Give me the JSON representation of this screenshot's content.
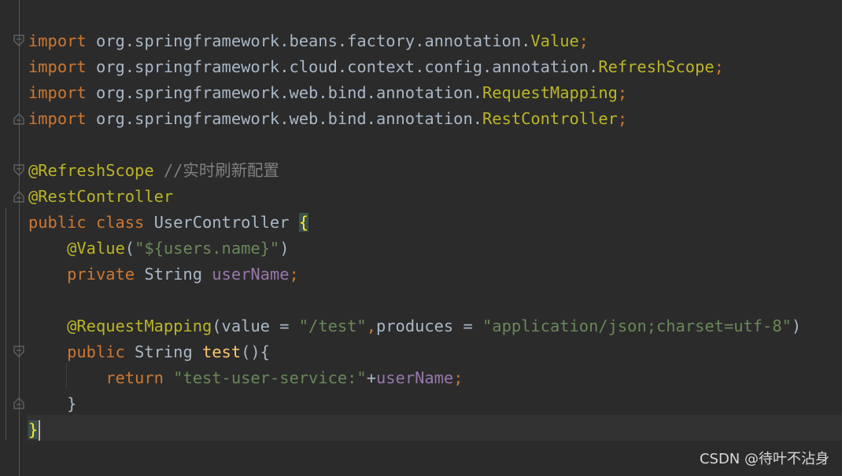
{
  "colors": {
    "keyword": "#cc7832",
    "annotation": "#bbb529",
    "string": "#6a8759",
    "field": "#9876aa",
    "plain": "#a9b7c6",
    "comment": "#808080",
    "method": "#ffc66d",
    "background": "#2b2b2b"
  },
  "icons": [
    "fold-open-icon",
    "fold-close-icon"
  ],
  "code": {
    "lines": [
      {
        "tokens": [
          {
            "t": "import",
            "c": "keyword"
          },
          {
            "t": " org.springframework.beans.factory.annotation.",
            "c": "plain"
          },
          {
            "t": "Value",
            "c": "annotation"
          },
          {
            "t": ";",
            "c": "keyword"
          }
        ]
      },
      {
        "tokens": [
          {
            "t": "import",
            "c": "keyword"
          },
          {
            "t": " org.springframework.cloud.context.config.annotation.",
            "c": "plain"
          },
          {
            "t": "RefreshScope",
            "c": "annotation"
          },
          {
            "t": ";",
            "c": "keyword"
          }
        ]
      },
      {
        "tokens": [
          {
            "t": "import",
            "c": "keyword"
          },
          {
            "t": " org.springframework.web.bind.annotation.",
            "c": "plain"
          },
          {
            "t": "RequestMapping",
            "c": "annotation"
          },
          {
            "t": ";",
            "c": "keyword"
          }
        ]
      },
      {
        "tokens": [
          {
            "t": "import",
            "c": "keyword"
          },
          {
            "t": " org.springframework.web.bind.annotation.",
            "c": "plain"
          },
          {
            "t": "RestController",
            "c": "annotation"
          },
          {
            "t": ";",
            "c": "keyword"
          }
        ]
      },
      {
        "tokens": []
      },
      {
        "tokens": [
          {
            "t": "@RefreshScope",
            "c": "annotation"
          },
          {
            "t": " //实时刷新配置",
            "c": "comment"
          }
        ]
      },
      {
        "tokens": [
          {
            "t": "@RestController",
            "c": "annotation"
          }
        ]
      },
      {
        "tokens": [
          {
            "t": "public class",
            "c": "keyword"
          },
          {
            "t": " UserController ",
            "c": "plain"
          },
          {
            "t": "{",
            "c": "brace"
          }
        ]
      },
      {
        "tokens": [
          {
            "t": "    ",
            "c": "plain"
          },
          {
            "t": "@Value",
            "c": "annotation"
          },
          {
            "t": "(",
            "c": "plain"
          },
          {
            "t": "\"${users.name}\"",
            "c": "string"
          },
          {
            "t": ")",
            "c": "plain"
          }
        ]
      },
      {
        "tokens": [
          {
            "t": "    ",
            "c": "plain"
          },
          {
            "t": "private",
            "c": "keyword"
          },
          {
            "t": " String ",
            "c": "plain"
          },
          {
            "t": "userName",
            "c": "field"
          },
          {
            "t": ";",
            "c": "keyword"
          }
        ]
      },
      {
        "tokens": []
      },
      {
        "tokens": [
          {
            "t": "    ",
            "c": "plain"
          },
          {
            "t": "@RequestMapping",
            "c": "annotation"
          },
          {
            "t": "(value = ",
            "c": "plain"
          },
          {
            "t": "\"/test\"",
            "c": "string"
          },
          {
            "t": ",",
            "c": "keyword"
          },
          {
            "t": "produces = ",
            "c": "plain"
          },
          {
            "t": "\"application/json;charset=utf-8\"",
            "c": "string"
          },
          {
            "t": ")",
            "c": "plain"
          }
        ]
      },
      {
        "tokens": [
          {
            "t": "    ",
            "c": "plain"
          },
          {
            "t": "public",
            "c": "keyword"
          },
          {
            "t": " String ",
            "c": "plain"
          },
          {
            "t": "test",
            "c": "method"
          },
          {
            "t": "(){",
            "c": "plain"
          }
        ]
      },
      {
        "tokens": [
          {
            "t": "        ",
            "c": "plain"
          },
          {
            "t": "return",
            "c": "keyword"
          },
          {
            "t": " ",
            "c": "plain"
          },
          {
            "t": "\"test-user-service:\"",
            "c": "string"
          },
          {
            "t": "+",
            "c": "plain"
          },
          {
            "t": "userName",
            "c": "field"
          },
          {
            "t": ";",
            "c": "keyword"
          }
        ]
      },
      {
        "tokens": [
          {
            "t": "    }",
            "c": "plain"
          }
        ]
      },
      {
        "tokens": [
          {
            "t": "}",
            "c": "brace"
          }
        ]
      }
    ]
  },
  "watermark": "CSDN @待叶不沾身"
}
